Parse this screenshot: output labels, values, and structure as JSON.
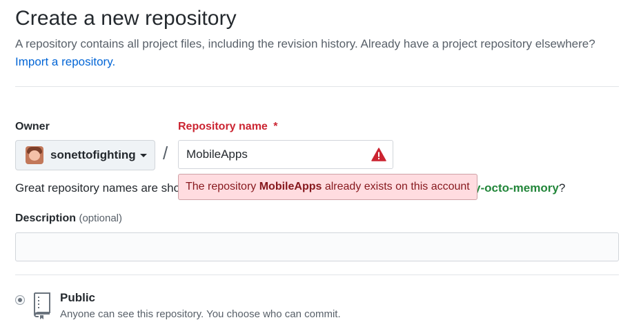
{
  "header": {
    "title": "Create a new repository",
    "subtitle": "A repository contains all project files, including the revision history. Already have a project repository elsewhere?",
    "import_link": "Import a repository."
  },
  "owner": {
    "label": "Owner",
    "selected": "sonettofighting",
    "avatar_icon": "avatar-image"
  },
  "separator": "/",
  "repo_name": {
    "label": "Repository name",
    "required_marker": "*",
    "value": "MobileApps",
    "status": "error",
    "warning_icon": "alert-triangle-icon",
    "error_tooltip": {
      "prefix": "The repository ",
      "name": "MobileApps",
      "suffix": " already exists on this account"
    }
  },
  "hint": {
    "prefix": "Great repository names are sho",
    "suggestion_visible": "y-octo-memory",
    "end": "?"
  },
  "description": {
    "label": "Description",
    "optional": "(optional)",
    "value": ""
  },
  "visibility": {
    "options": [
      {
        "label": "Public",
        "description": "Anyone can see this repository. You choose who can commit.",
        "selected": true,
        "icon": "repo-book-icon"
      }
    ]
  },
  "colors": {
    "error": "#cb2431",
    "link": "#0366d6",
    "suggestion": "#22863a",
    "error_bg": "#ffdce0"
  }
}
